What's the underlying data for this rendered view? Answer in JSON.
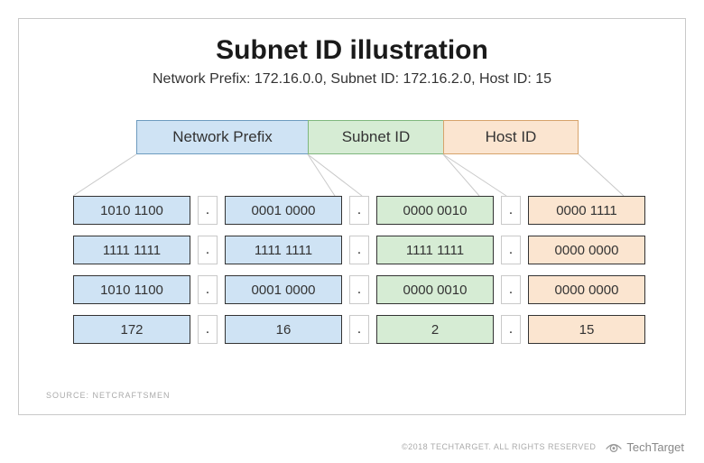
{
  "title": "Subnet ID illustration",
  "subtitle": "Network Prefix: 172.16.0.0, Subnet ID: 172.16.2.0, Host ID: 15",
  "headers": {
    "network_prefix": "Network Prefix",
    "subnet_id": "Subnet ID",
    "host_id": "Host ID"
  },
  "dot": ".",
  "rows": [
    {
      "o1": "1010 1100",
      "o2": "0001 0000",
      "o3": "0000 0010",
      "o4": "0000 1111"
    },
    {
      "o1": "1111 1111",
      "o2": "1111 1111",
      "o3": "1111 1111",
      "o4": "0000 0000"
    },
    {
      "o1": "1010 1100",
      "o2": "0001 0000",
      "o3": "0000 0010",
      "o4": "0000 0000"
    },
    {
      "o1": "172",
      "o2": "16",
      "o3": "2",
      "o4": "15"
    }
  ],
  "source_label": "SOURCE: NETCRAFTSMEN",
  "copyright": "©2018 TECHTARGET. ALL RIGHTS RESERVED",
  "brand": "TechTarget",
  "colors": {
    "blue_fill": "#cfe3f4",
    "blue_border": "#6d9bbf",
    "green_fill": "#d6ecd4",
    "green_border": "#7fb77d",
    "peach_fill": "#fbe5d0",
    "peach_border": "#d7a36b",
    "frame_border": "#c9c9c9"
  }
}
